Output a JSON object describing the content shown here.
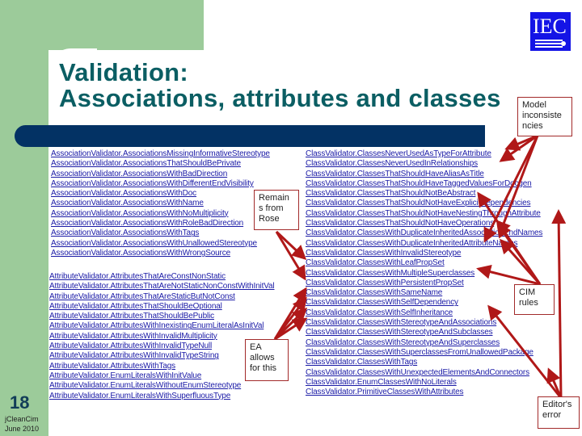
{
  "slide": {
    "title_line1": "Validation:",
    "title_line2": "Associations, attributes and classes",
    "logo_text": "IEC",
    "page_number": "18",
    "footer_line1": "jCleanCim",
    "footer_line2": "June 2010"
  },
  "association_validators": [
    "AssociationValidator.AssociationsMissingInformativeStereotype",
    "AssociationValidator.AssociationsThatShouldBePrivate",
    "AssociationValidator.AssociationsWithBadDirection",
    "AssociationValidator.AssociationsWithDifferentEndVisibility",
    "AssociationValidator.AssociationsWithDoc",
    "AssociationValidator.AssociationsWithName",
    "AssociationValidator.AssociationsWithNoMultiplicity",
    "AssociationValidator.AssociationsWithRoleBadDirection",
    "AssociationValidator.AssociationsWithTags",
    "AssociationValidator.AssociationsWithUnallowedStereotype",
    "AssociationValidator.AssociationsWithWrongSource"
  ],
  "attribute_validators": [
    "AttributeValidator.AttributesThatAreConstNonStatic",
    "AttributeValidator.AttributesThatAreNotStaticNonConstWithInitVal",
    "AttributeValidator.AttributesThatAreStaticButNotConst",
    "AttributeValidator.AttributesThatShouldBeOptional",
    "AttributeValidator.AttributesThatShouldBePublic",
    "AttributeValidator.AttributesWithInexistingEnumLiteralAsInitVal",
    "AttributeValidator.AttributesWithInvalidMultiplicity",
    "AttributeValidator.AttributesWithInvalidTypeNull",
    "AttributeValidator.AttributesWithInvalidTypeString",
    "AttributeValidator.AttributesWithTags",
    "AttributeValidator.EnumLiteralsWithInitValue",
    "AttributeValidator.EnumLiteralsWithoutEnumStereotype",
    "AttributeValidator.EnumLiteralsWithSuperfluousType"
  ],
  "class_validators": [
    "ClassValidator.ClassesNeverUsedAsTypeForAttribute",
    "ClassValidator.ClassesNeverUsedInRelationships",
    "ClassValidator.ClassesThatShouldHaveAliasAsTitle",
    "ClassValidator.ClassesThatShouldHaveTaggedValuesForDocgen",
    "ClassValidator.ClassesThatShouldNotBeAbstract",
    "ClassValidator.ClassesThatShouldNotHaveExplicitDependencies",
    "ClassValidator.ClassesThatShouldNotHaveNestingThroughAttribute",
    "ClassValidator.ClassesThatShouldNotHaveOperations",
    "ClassValidator.ClassesWithDuplicateInheritedAssociationEndNames",
    "ClassValidator.ClassesWithDuplicateInheritedAttributeNames",
    "ClassValidator.ClassesWithInvalidStereotype",
    "ClassValidator.ClassesWithLeafPropSet",
    "ClassValidator.ClassesWithMultipleSuperclasses",
    "ClassValidator.ClassesWithPersistentPropSet",
    "ClassValidator.ClassesWithSameName",
    "ClassValidator.ClassesWithSelfDependency",
    "ClassValidator.ClassesWithSelfInheritance",
    "ClassValidator.ClassesWithStereotypeAndAssociations",
    "ClassValidator.ClassesWithStereotypeAndSubclasses",
    "ClassValidator.ClassesWithStereotypeAndSuperclasses",
    "ClassValidator.ClassesWithSuperclassesFromUnallowedPackage",
    "ClassValidator.ClassesWithTags",
    "ClassValidator.ClassesWithUnexpectedElementsAndConnectors",
    "ClassValidator.EnumClassesWithNoLiterals",
    "ClassValidator.PrimitiveClassesWithAttributes"
  ],
  "callouts": {
    "model_inconsistencies": "Model inconsiste ncies",
    "remains_from_rose": "Remain s from Rose",
    "cim_rules": "CIM rules",
    "ea_allows": "EA allows for this",
    "editors_error": "Editor's error"
  },
  "colors": {
    "sidebar_green": "#9ccb9a",
    "title_teal": "#0b5e63",
    "bar_navy": "#033264",
    "link_blue": "#1a1aa6",
    "arrow_red": "#b01818",
    "logo_blue": "#1414e6"
  }
}
